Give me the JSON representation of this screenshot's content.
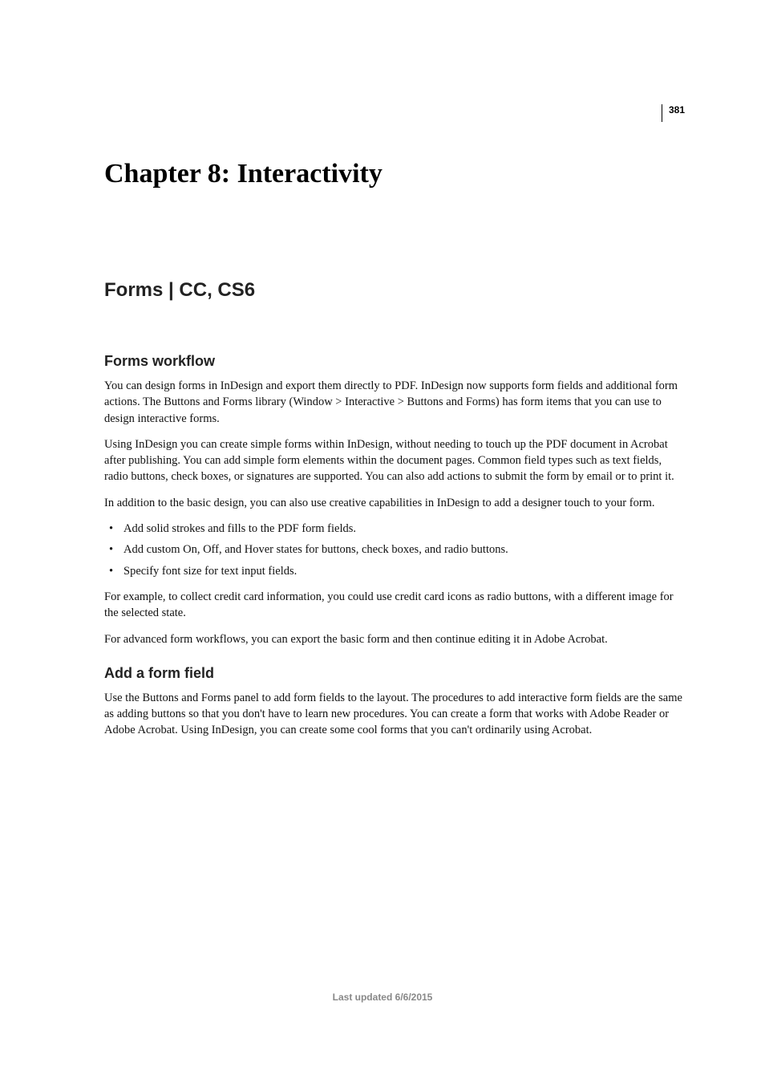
{
  "page_number": "381",
  "chapter_title": "Chapter 8: Interactivity",
  "section_title": "Forms | CC, CS6",
  "subsection1": {
    "title": "Forms workflow",
    "p1": "You can design forms in InDesign and export them directly to PDF. InDesign now supports form fields and additional form actions. The Buttons and Forms library (Window > Interactive > Buttons and Forms) has form items that you can use to design interactive forms.",
    "p2": "Using InDesign you can create simple forms within InDesign, without needing to touch up the PDF document in Acrobat after publishing. You can add simple form elements within the document pages. Common field types such as text fields, radio buttons, check boxes, or signatures are supported. You can also add actions to submit the form by email or to print it.",
    "p3": "In addition to the basic design, you can also use creative capabilities in InDesign to add a designer touch to your form.",
    "bullets": [
      "Add solid strokes and fills to the PDF form fields.",
      "Add custom On, Off, and Hover states for buttons, check boxes, and radio buttons.",
      "Specify font size for text input fields."
    ],
    "p4": "For example, to collect credit card information, you could use credit card icons as radio buttons, with a different image for the selected state.",
    "p5": "For advanced form workflows, you can export the basic form and then continue editing it in Adobe Acrobat."
  },
  "subsection2": {
    "title": "Add a form field",
    "p1": "Use the Buttons and Forms panel to add form fields to the layout. The procedures to add interactive form fields are the same as adding buttons so that you don't have to learn new procedures. You can create a form that works with Adobe Reader or Adobe Acrobat. Using InDesign, you can create some cool forms that you can't ordinarily using Acrobat."
  },
  "footer": "Last updated 6/6/2015"
}
